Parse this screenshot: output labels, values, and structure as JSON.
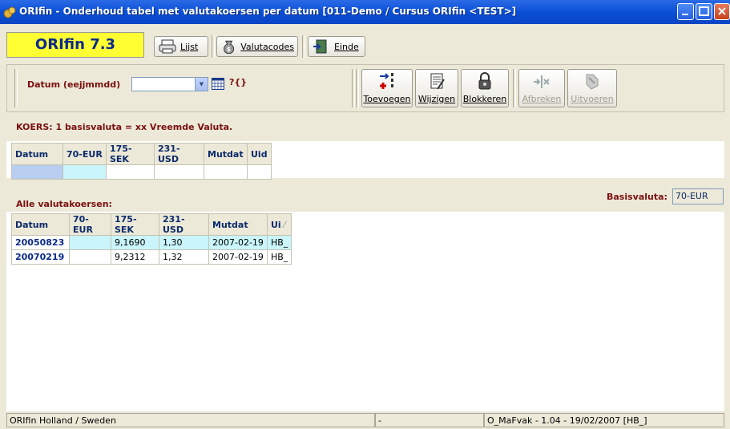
{
  "window": {
    "title": "ORIfin - Onderhoud tabel met valutakoersen per datum [011-Demo / Cursus ORIfin <TEST>]"
  },
  "logo": {
    "text": "ORIfin 7.3"
  },
  "toolbar": {
    "lijst": "Lijst",
    "valutacodes": "Valutacodes",
    "einde": "Einde"
  },
  "filter": {
    "date_label": "Datum (eejjmmdd)",
    "date_value": "",
    "help_glyph": "?{}"
  },
  "actions": {
    "toevoegen": "Toevoegen",
    "wijzigen": "Wijzigen",
    "blokkeren": "Blokkeren",
    "afbreken": "Afbreken",
    "uitvoeren": "Uitvoeren"
  },
  "koers_note": "KOERS:  1 basisvaluta = xx Vreemde Valuta.",
  "edit_grid": {
    "headers": [
      "Datum",
      "70-EUR",
      "175-SEK",
      "231-USD",
      "Mutdat",
      "Uid"
    ]
  },
  "alle_label": "Alle valutakoersen:",
  "basis": {
    "label": "Basisvaluta:",
    "value": "70-EUR"
  },
  "list_grid": {
    "headers": [
      "Datum",
      "70-EUR",
      "175-SEK",
      "231-USD",
      "Mutdat",
      "Ui"
    ],
    "rows": [
      {
        "datum": "20050823",
        "eur": "",
        "sek": "9,1690",
        "usd": "1,30",
        "mutdat": "2007-02-19",
        "uid": "HB_"
      },
      {
        "datum": "20070219",
        "eur": "",
        "sek": "9,2312",
        "usd": "1,32",
        "mutdat": "2007-02-19",
        "uid": "HB_"
      }
    ]
  },
  "status": {
    "left": "ORIfin Holland / Sweden",
    "middle": "-",
    "right": "O_MaFvak - 1.04 - 19/02/2007 [HB_]"
  }
}
